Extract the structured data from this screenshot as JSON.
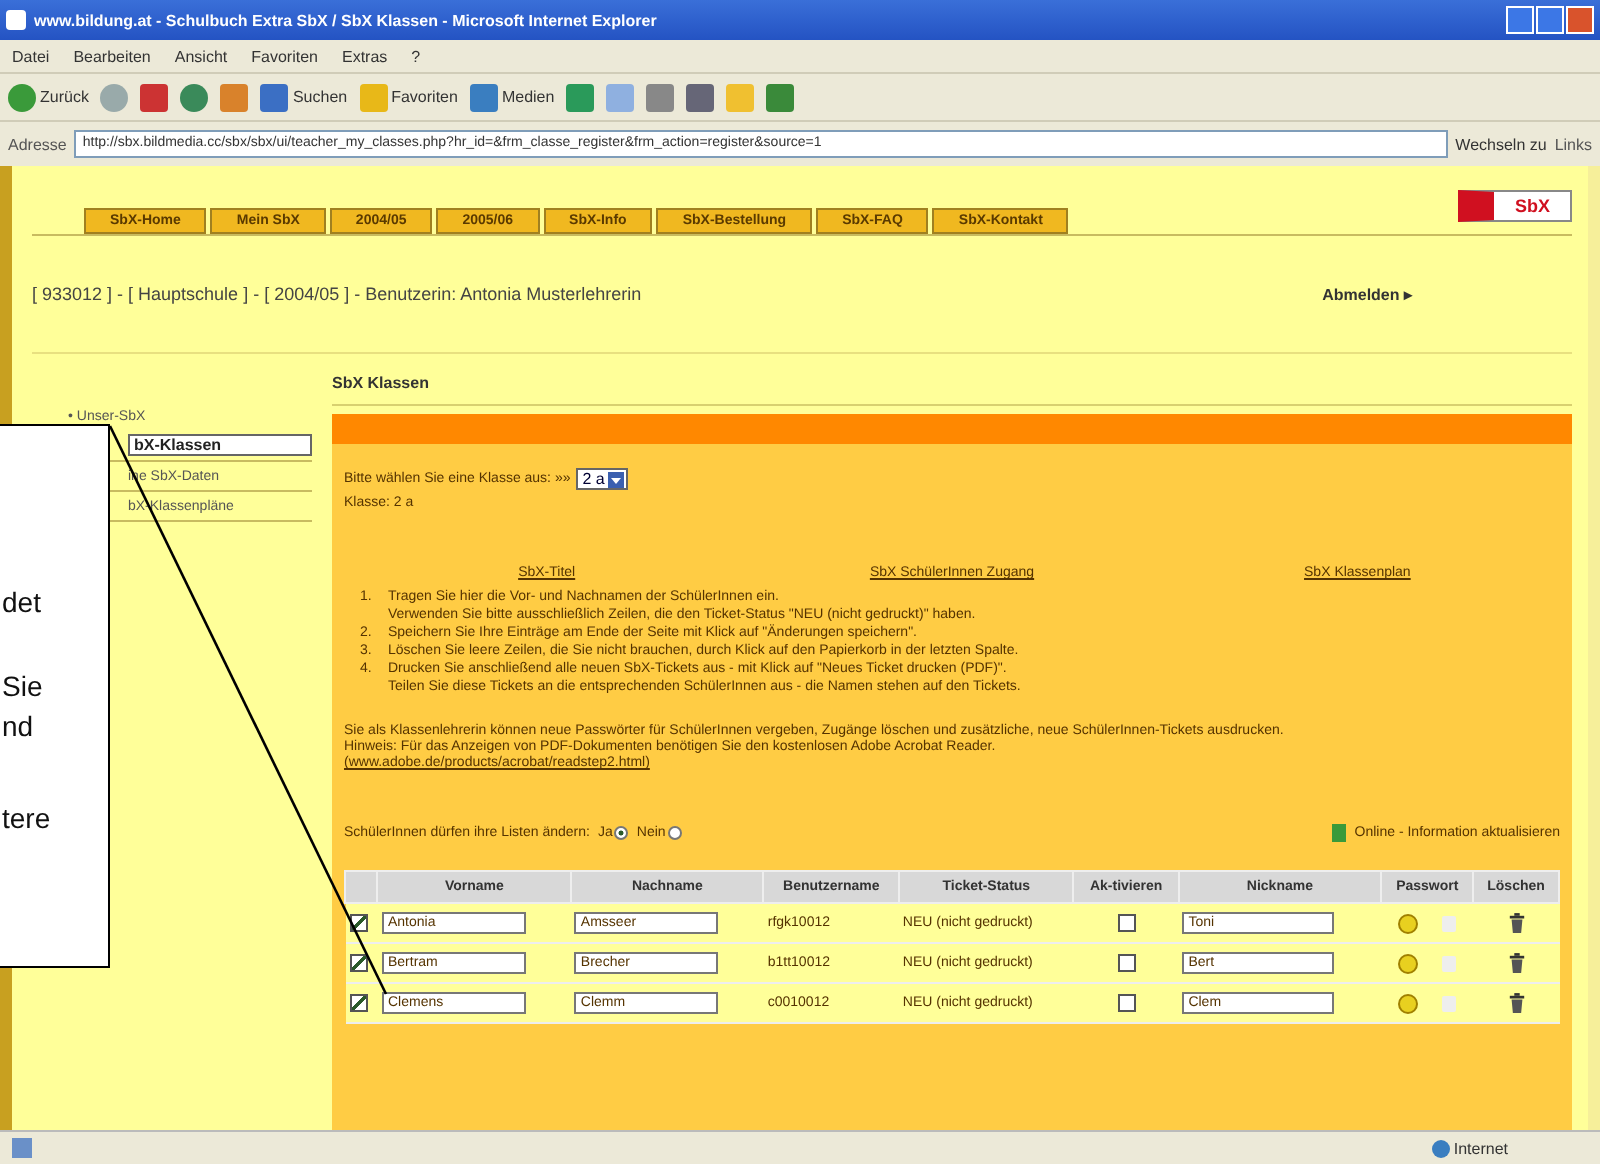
{
  "browser": {
    "title": "www.bildung.at - Schulbuch Extra SbX / SbX Klassen - Microsoft Internet Explorer",
    "menu": [
      "Datei",
      "Bearbeiten",
      "Ansicht",
      "Favoriten",
      "Extras",
      "?"
    ],
    "toolbar": [
      {
        "kind": "back",
        "label": "Zurück"
      },
      {
        "kind": "forward"
      },
      {
        "kind": "stop"
      },
      {
        "kind": "refresh"
      },
      {
        "kind": "home"
      },
      {
        "kind": "search",
        "label": "Suchen"
      },
      {
        "kind": "favorites",
        "label": "Favoriten"
      },
      {
        "kind": "media",
        "label": "Medien"
      },
      {
        "kind": "history"
      },
      {
        "kind": "mail"
      },
      {
        "kind": "print"
      },
      {
        "kind": "edit"
      },
      {
        "kind": "folder"
      },
      {
        "kind": "messenger"
      }
    ],
    "address_label": "Adresse",
    "url": "http://sbx.bildmedia.cc/sbx/sbx/ui/teacher_my_classes.php?hr_id=&frm_classe_register&frm_action=register&source=1",
    "go_label": "Wechseln zu",
    "links_label": "Links"
  },
  "page": {
    "tabs": [
      "SbX-Home",
      "Mein SbX",
      "2004/05",
      "2005/06",
      "SbX-Info",
      "SbX-Bestellung",
      "SbX-FAQ",
      "SbX-Kontakt"
    ],
    "logo": "SbX",
    "breadcrumb": "[ 933012 ] - [ Hauptschule ] - [ 2004/05 ] - Benutzerin: Antonia Musterlehrerin",
    "logout": "Abmelden ▸",
    "sidebar": [
      {
        "label": "• Unser-SbX",
        "selected": false
      },
      {
        "label": "bX-Klassen",
        "selected": true
      },
      {
        "label": "ine SbX-Daten",
        "selected": false
      },
      {
        "label": "bX-Klassenpläne",
        "selected": false
      }
    ],
    "heading": "SbX Klassen",
    "select_prompt": "Bitte wählen Sie eine Klasse aus: »»",
    "select_value": "2 a",
    "class_label": "Klasse: 2 a",
    "subtabs": [
      "SbX-Titel",
      "SbX SchülerInnen Zugang",
      "SbX Klassenplan"
    ],
    "steps": [
      {
        "num": "1.",
        "lines": [
          "Tragen Sie hier die Vor- und Nachnamen der SchülerInnen ein.",
          "Verwenden Sie bitte ausschließlich Zeilen, die den Ticket-Status \"NEU (nicht gedruckt)\" haben."
        ]
      },
      {
        "num": "2.",
        "lines": [
          "Speichern Sie Ihre Einträge am Ende der Seite mit Klick auf \"Änderungen speichern\"."
        ]
      },
      {
        "num": "3.",
        "lines": [
          "Löschen Sie leere Zeilen, die Sie nicht brauchen, durch Klick auf den Papierkorb in der letzten Spalte."
        ]
      },
      {
        "num": "4.",
        "lines": [
          "Drucken Sie anschließend alle neuen SbX-Tickets aus - mit Klick auf \"Neues Ticket drucken (PDF)\".",
          "Teilen Sie diese Tickets an die entsprechenden SchülerInnen aus - die Namen stehen auf den Tickets."
        ]
      }
    ],
    "info": "Sie als Klassenlehrerin können neue Passwörter für SchülerInnen vergeben, Zugänge löschen und zusätzliche, neue SchülerInnen-Tickets ausdrucken.",
    "hint": "Hinweis: Für das Anzeigen von PDF-Dokumenten benötigen Sie den kostenlosen Adobe Acrobat Reader.",
    "hint_link": "(www.adobe.de/products/acrobat/readstep2.html)",
    "edit_question": "SchülerInnen dürfen ihre Listen ändern:",
    "edit_options": [
      {
        "label": "Ja",
        "selected": true
      },
      {
        "label": "Nein",
        "selected": false
      }
    ],
    "refresh": "Online - Information aktualisieren",
    "columns": [
      "Vorname",
      "Nachname",
      "Benutzername",
      "Ticket-Status",
      "Ak-tivieren",
      "Nickname",
      "Passwort",
      "Löschen"
    ],
    "rows": [
      {
        "checked": true,
        "first": "Antonia",
        "last": "Amsseer",
        "user": "rfgk10012",
        "status": "NEU (nicht gedruckt)",
        "activate": false,
        "nickname": "Toni"
      },
      {
        "checked": true,
        "first": "Bertram",
        "last": "Brecher",
        "user": "b1tt10012",
        "status": "NEU (nicht gedruckt)",
        "activate": false,
        "nickname": "Bert"
      },
      {
        "checked": true,
        "first": "Clemens",
        "last": "Clemm",
        "user": "c0010012",
        "status": "NEU (nicht gedruckt)",
        "activate": false,
        "nickname": "Clem"
      }
    ]
  },
  "callout": [
    "det",
    "Sie",
    "nd",
    "tere"
  ],
  "status_bar": {
    "zone": "Internet"
  }
}
